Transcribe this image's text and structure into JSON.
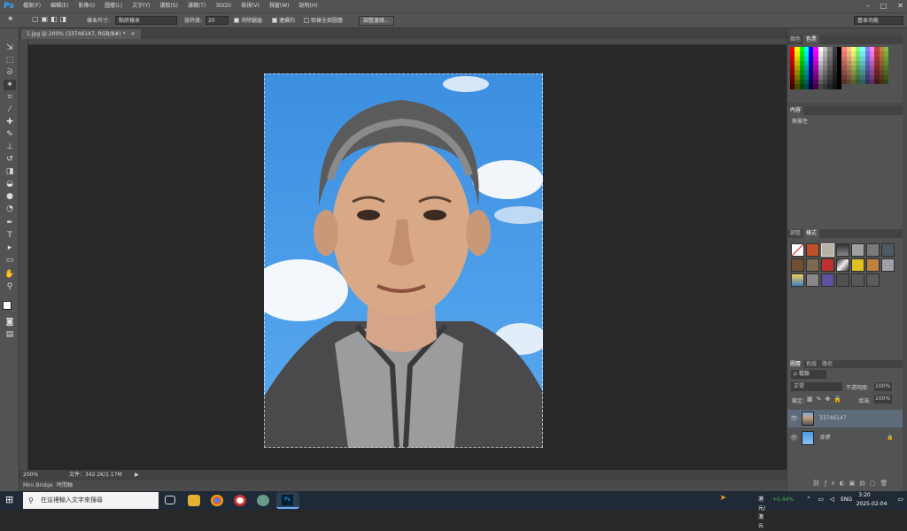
{
  "menubar": {
    "logo": "Ps",
    "items": [
      "檔案(F)",
      "編輯(E)",
      "影像(I)",
      "圖層(L)",
      "文字(Y)",
      "選取(S)",
      "濾鏡(T)",
      "3D(D)",
      "檢視(V)",
      "視窗(W)",
      "說明(H)"
    ],
    "window_controls": [
      "–",
      "□",
      "✕"
    ]
  },
  "options": {
    "sample_size_label": "樣本尺寸:",
    "sample_size_value": "點狀樣本",
    "tolerance_label": "容許度:",
    "tolerance_value": "20",
    "antialias_label": "消除鋸齒",
    "contiguous_label": "連續的",
    "sample_all_label": "取樣全部圖層",
    "refine_edge_button": "調整邊緣...",
    "workspace_value": "基本功能"
  },
  "document": {
    "tab_title": "1.jpg @ 200% (33746147, RGB/8#) *",
    "zoom": "200%",
    "doc_info": "文件：342.2K/1.17M"
  },
  "bottom_tabs": [
    "Mini Bridge",
    "時間軸"
  ],
  "panels": {
    "swatches_tabs": [
      "顏色",
      "色票"
    ],
    "properties_tab": "內容",
    "properties_text": "無屬性",
    "styles_tabs": [
      "調整",
      "樣式"
    ],
    "layers_tabs": [
      "圖層",
      "色版",
      "路徑"
    ],
    "layer_kind": "種類",
    "blend_mode": "正常",
    "opacity_label": "不透明度:",
    "opacity_value": "100%",
    "lock_label": "鎖定:",
    "fill_label": "填滿:",
    "fill_value": "100%",
    "layers": [
      {
        "name": "33746147",
        "selected": true
      },
      {
        "name": "背景",
        "selected": false
      }
    ]
  },
  "taskbar": {
    "search_placeholder": "在這裡輸入文字來搜尋",
    "stock_name": "港元/澳元",
    "stock_change": "+0.44%",
    "lang": "ENG",
    "time": "3:20",
    "date": "2025-02-04"
  },
  "colors": {
    "accent": "#31a8ff",
    "stock_up": "#4caf50"
  }
}
